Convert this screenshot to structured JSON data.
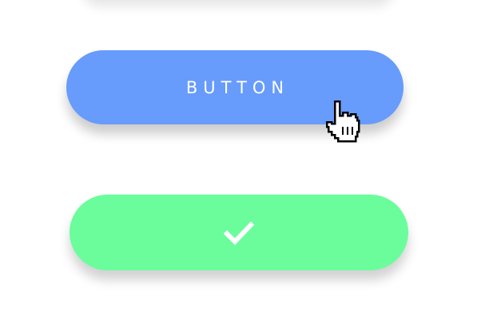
{
  "primary_button": {
    "label": "BUTTON",
    "color": "#679BFC"
  },
  "success_button": {
    "icon": "checkmark-icon",
    "color": "#6BFD9C"
  },
  "cursor": {
    "icon": "hand-pointer-cursor-icon"
  }
}
